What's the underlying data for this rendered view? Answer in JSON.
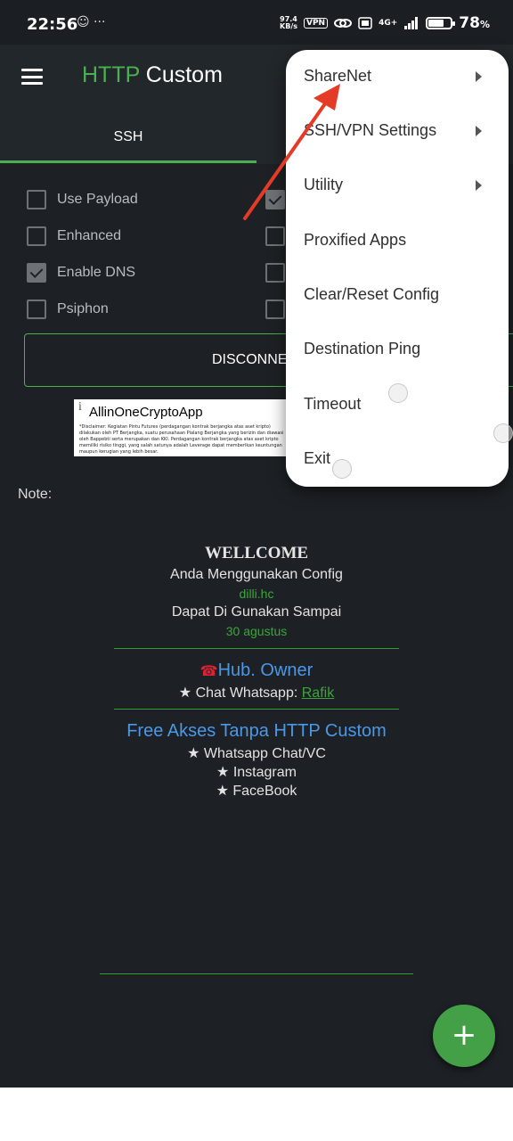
{
  "status_bar": {
    "time": "22:56",
    "left_icons": "☺ ···",
    "speed_top": "97.4",
    "speed_bottom": "KB/s",
    "vpn": "VPN",
    "network": "4G+",
    "battery_percent": 78,
    "battery_text": "78",
    "battery_unit": "%"
  },
  "toolbar": {
    "title_http": "HTTP",
    "title_custom": " Custom"
  },
  "tabs": [
    {
      "label": "SSH"
    }
  ],
  "checkboxes": [
    {
      "label": "Use Payload",
      "checked": false
    },
    {
      "label": "Enhanced",
      "checked": false
    },
    {
      "label": "Enable DNS",
      "checked": true
    },
    {
      "label": "Psiphon",
      "checked": false
    }
  ],
  "right_checkboxes": [
    {
      "checked": true
    },
    {
      "checked": false
    },
    {
      "checked": false
    },
    {
      "checked": false
    }
  ],
  "connect_button": "DISCONNECT",
  "ad": {
    "info_icon": "i",
    "title": "AllinOneCryptoApp",
    "text": "*Disclaimer: Kegiatan Pintu Futures (perdagangan kontrak berjangka atas aset kripto) dilakukan oleh PT Berjangka, suatu perusahaan Pialang Berjangka yang berizin dan diawasi oleh Bappebti serta merupakan dan KKI. Perdagangan kontrak berjangka atas aset kripto memiliki risiko tinggi, yang salah satunya adalah Leverage dapat memberikan keuntungan maupun kerugian yang lebih besar."
  },
  "note_label": "Note:",
  "note": {
    "wellcome": "WELLCOME",
    "line1": "Anda Menggunakan Config",
    "config_name": "dilli.hc",
    "line2": "Dapat Di Gunakan Sampai",
    "expiry": "30 agustus",
    "owner_icon": "☎",
    "owner_title": "Hub. Owner",
    "chat_prefix": "★ Chat Whatsapp: ",
    "chat_name": "Rafik ",
    "free_title": "Free Akses Tanpa HTTP Custom",
    "items": [
      "★ Whatsapp Chat/VC",
      "★ Instagram",
      "★ FaceBook"
    ]
  },
  "fab_icon": "+",
  "menu": {
    "items": [
      {
        "label": "ShareNet",
        "submenu": true
      },
      {
        "label": "SSH/VPN Settings",
        "submenu": true
      },
      {
        "label": "Utility",
        "submenu": true
      },
      {
        "label": "Proxified Apps",
        "submenu": false
      },
      {
        "label": "Clear/Reset Config",
        "submenu": false
      },
      {
        "label": "Destination Ping",
        "submenu": false
      },
      {
        "label": "Timeout",
        "submenu": false
      },
      {
        "label": "Exit",
        "submenu": false
      }
    ]
  },
  "colors": {
    "accent": "#4caf50",
    "background": "#1d2125",
    "link_blue": "#4a98e8",
    "annotation_arrow": "#e53a26"
  }
}
